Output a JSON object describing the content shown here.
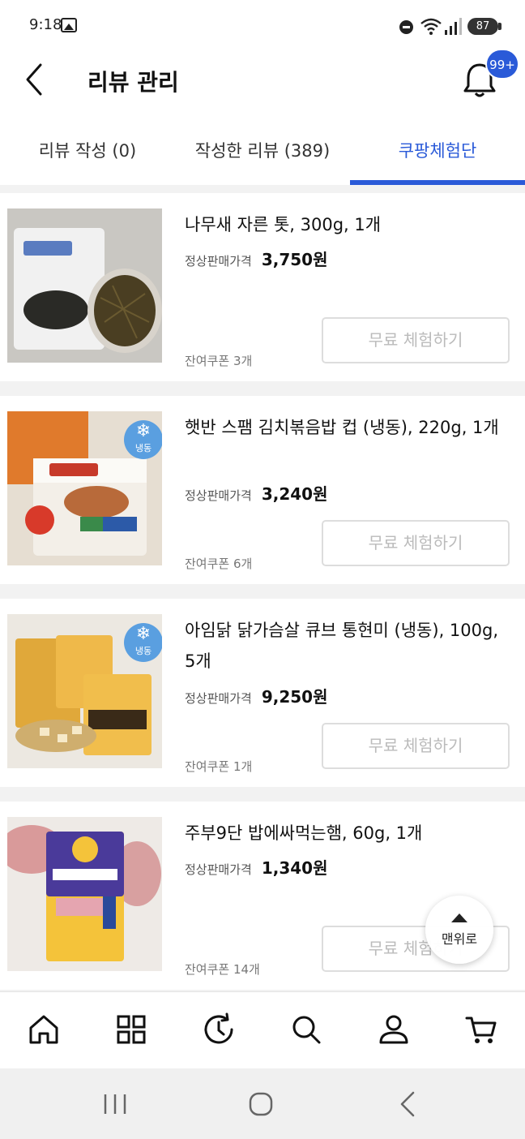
{
  "status_bar": {
    "time": "9:18",
    "battery": "87",
    "icons": [
      "gallery-icon",
      "do-not-disturb-icon",
      "wifi-icon",
      "signal-icon",
      "battery-icon"
    ]
  },
  "header": {
    "title": "리뷰 관리",
    "notification_badge": "99+",
    "accent_color": "#2a5ad8"
  },
  "tabs": [
    {
      "label": "리뷰 작성 (0)",
      "active": false
    },
    {
      "label": "작성한 리뷰 (389)",
      "active": false
    },
    {
      "label": "쿠팡체험단",
      "active": true
    }
  ],
  "products": [
    {
      "name": "나무새 자른 톳, 300g, 1개",
      "price_label": "정상판매가격",
      "price": "3,750원",
      "coupon": "잔여쿠폰 3개",
      "button": "무료 체험하기",
      "frozen": false
    },
    {
      "name": "햇반 스팸 김치볶음밥 컵 (냉동), 220g, 1개",
      "price_label": "정상판매가격",
      "price": "3,240원",
      "coupon": "잔여쿠폰 6개",
      "button": "무료 체험하기",
      "frozen": true,
      "frozen_label": "냉동"
    },
    {
      "name": "아임닭 닭가슴살 큐브 통현미 (냉동), 100g, 5개",
      "price_label": "정상판매가격",
      "price": "9,250원",
      "coupon": "잔여쿠폰 1개",
      "button": "무료 체험하기",
      "frozen": true,
      "frozen_label": "냉동"
    },
    {
      "name": "주부9단 밥에싸먹는햄, 60g, 1개",
      "price_label": "정상판매가격",
      "price": "1,340원",
      "coupon": "잔여쿠폰 14개",
      "button": "무료 체험하기",
      "frozen": false
    }
  ],
  "scroll_top": {
    "label": "맨위로"
  },
  "bottom_nav": [
    "home-icon",
    "category-icon",
    "history-icon",
    "search-icon",
    "my-account-icon",
    "cart-icon"
  ],
  "system_nav": [
    "recent-apps-icon",
    "home-circle-icon",
    "system-back-icon"
  ]
}
